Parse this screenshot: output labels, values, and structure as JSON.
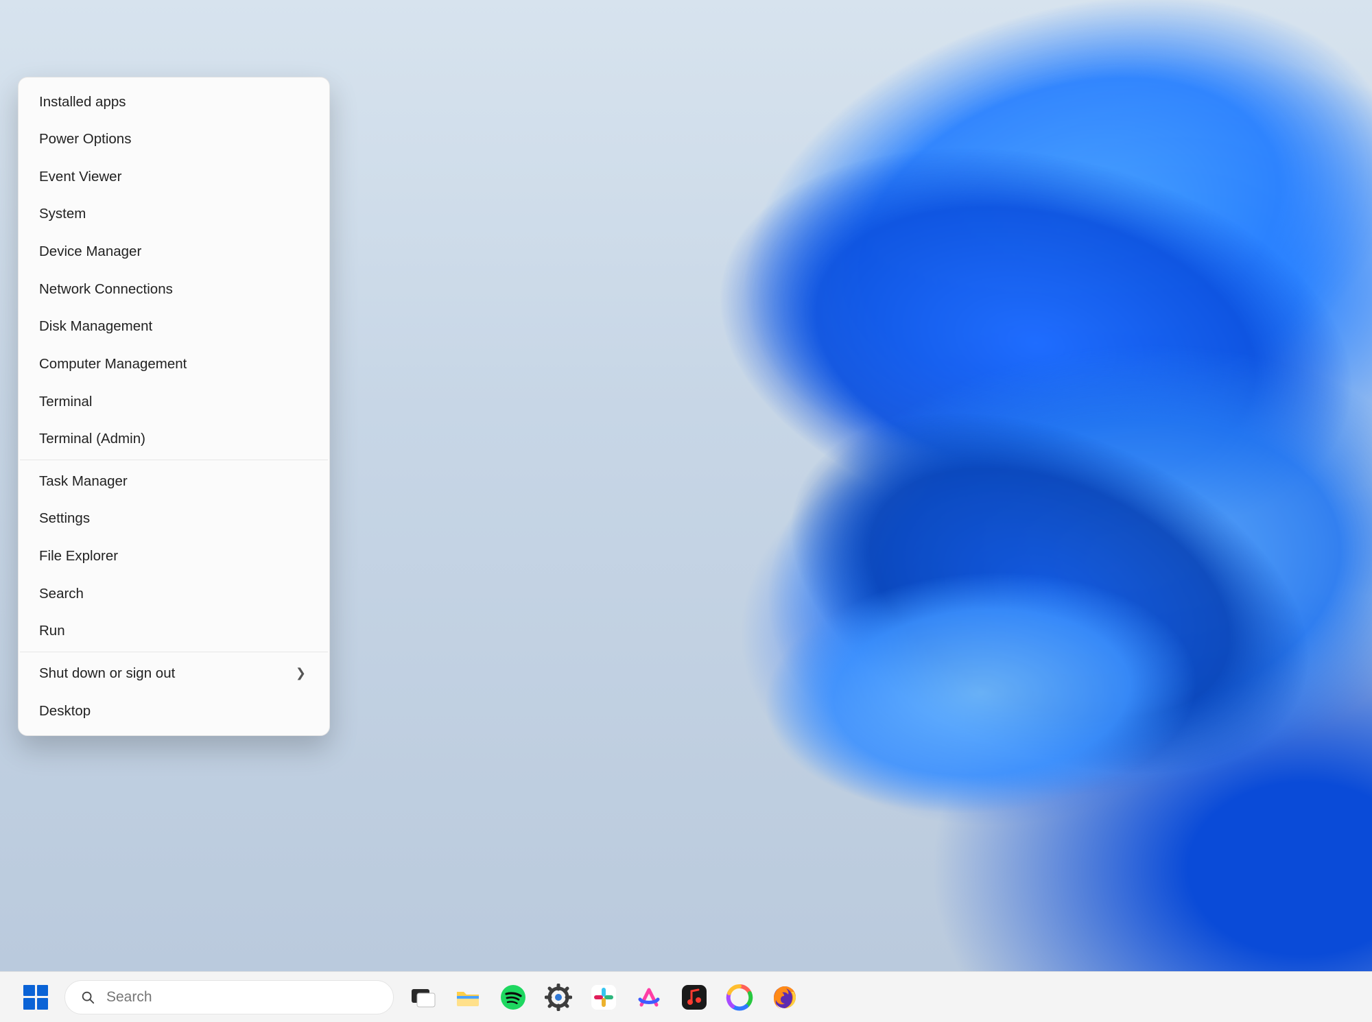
{
  "winx_menu": {
    "groups": [
      [
        "Installed apps",
        "Power Options",
        "Event Viewer",
        "System",
        "Device Manager",
        "Network Connections",
        "Disk Management",
        "Computer Management",
        "Terminal",
        "Terminal (Admin)"
      ],
      [
        "Task Manager",
        "Settings",
        "File Explorer",
        "Search",
        "Run"
      ],
      [
        {
          "label": "Shut down or sign out",
          "submenu": true
        },
        "Desktop"
      ]
    ]
  },
  "taskbar": {
    "search_placeholder": "Search",
    "apps": [
      {
        "id": "start",
        "name": "Start"
      },
      {
        "id": "search",
        "name": "Search"
      },
      {
        "id": "taskview",
        "name": "Task view"
      },
      {
        "id": "explorer",
        "name": "File Explorer"
      },
      {
        "id": "spotify",
        "name": "Spotify"
      },
      {
        "id": "settings",
        "name": "Settings"
      },
      {
        "id": "slack",
        "name": "Slack"
      },
      {
        "id": "arc",
        "name": "Arc"
      },
      {
        "id": "itunes",
        "name": "iTunes"
      },
      {
        "id": "copilot",
        "name": "Copilot"
      },
      {
        "id": "firefox",
        "name": "Firefox"
      }
    ]
  },
  "colors": {
    "accent": "#0a63d6",
    "menu_bg": "#fbfbfb",
    "taskbar_bg": "#f4f4f4"
  }
}
